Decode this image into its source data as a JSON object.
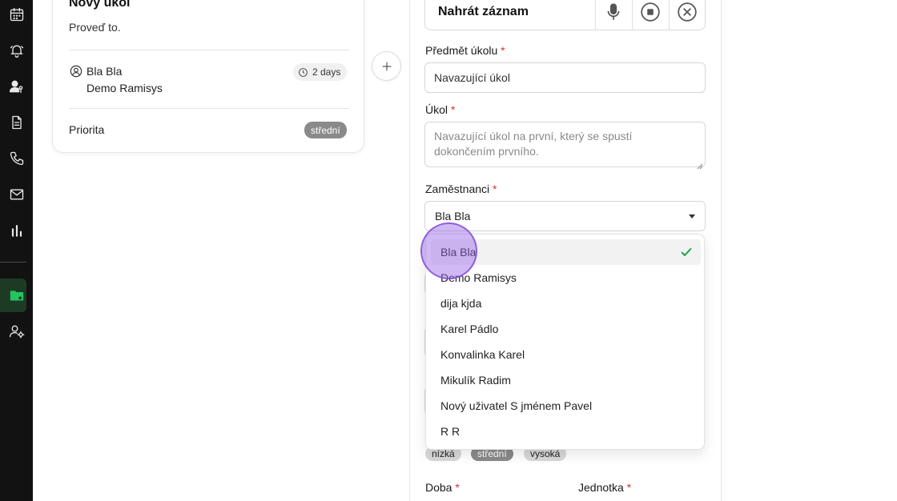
{
  "card": {
    "title": "Nový úkol",
    "description": "Proveď to.",
    "assignees": [
      "Bla Bla",
      "Demo Ramisys"
    ],
    "duration": "2 days",
    "priority_label": "Priorita",
    "priority_value": "střední"
  },
  "form": {
    "record_title": "Nahrát záznam",
    "subject_label": "Předmět úkolu",
    "subject_value": "Navazující úkol",
    "task_label": "Úkol",
    "task_placeholder": "Navazující úkol na první, který se spustí dokončením prvního.",
    "employees_label": "Zaměstnanci",
    "employees_value": "Bla Bla",
    "required_mark": "*",
    "priority_chips": [
      "nízká",
      "střední",
      "vysoká"
    ],
    "duration_label": "Doba",
    "unit_label": "Jednotka"
  },
  "dropdown": {
    "options": [
      "Bla Bla",
      "Demo Ramisys",
      "dija kjda",
      "Karel Pádlo",
      "Konvalinka Karel",
      "Mikulík Radim",
      "Nový uživatel S jménem Pavel",
      "R R"
    ],
    "selected_index": 0
  },
  "colors": {
    "sidebar_bg": "#121212",
    "accent_green": "#1aa14a",
    "required_red": "#d93030",
    "badge_gray": "#8a8a8a"
  }
}
